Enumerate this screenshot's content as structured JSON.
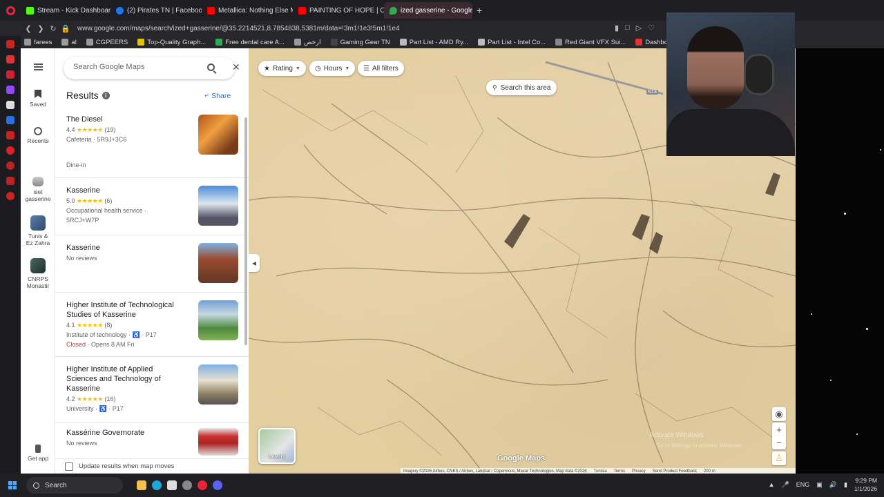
{
  "browser": {
    "tabs": [
      {
        "label": "Stream - Kick Dashboard",
        "color": "#53fc18",
        "active": false
      },
      {
        "label": "(2) Pirates TN | Facebook",
        "color": "#1877f2",
        "active": false
      },
      {
        "label": "Metallica: Nothing Else M",
        "color": "#ff0000",
        "active": false
      },
      {
        "label": "PAINTING OF HOPE | Offi",
        "color": "#ff0000",
        "active": false
      },
      {
        "label": "ized gasserine - Google M",
        "color": "#34a853",
        "active": true
      }
    ],
    "new_tab": "+",
    "url": "www.google.com/maps/search/ized+gasserine/@35.2214521,8.7854838,5381m/data=!3m1!1e3!5m1!1e4",
    "bookmarks": [
      {
        "label": "farees",
        "icon": "folder-icon",
        "color": "#9a9a9a"
      },
      {
        "label": "al",
        "icon": "folder-icon",
        "color": "#9a9a9a"
      },
      {
        "label": "CGPEERS",
        "icon": "folder-icon",
        "color": "#9a9a9a"
      },
      {
        "label": "Top-Quality Graph...",
        "icon": "graphics-icon",
        "color": "#e6c300"
      },
      {
        "label": "Free dental care A...",
        "icon": "dental-icon",
        "color": "#33aa55"
      },
      {
        "label": "ارخص",
        "icon": "folder-icon",
        "color": "#9a9a9a"
      },
      {
        "label": "Gaming Gear TN",
        "icon": "gear-site-icon",
        "color": "#444444"
      },
      {
        "label": "Part List - AMD Ry...",
        "icon": "partlist-icon",
        "color": "#bbbbbb"
      },
      {
        "label": "Part List - Intel Co...",
        "icon": "partlist-icon",
        "color": "#bbbbbb"
      },
      {
        "label": "Red Giant VFX Sui...",
        "icon": "redgiant-icon",
        "color": "#888888"
      },
      {
        "label": "Dashboard - BotG...",
        "icon": "dashboard-icon",
        "color": "#e33333"
      }
    ]
  },
  "rail": {
    "menu_icon": "menu-icon",
    "items": [
      {
        "label": "Saved",
        "icon": "bookmark-icon"
      },
      {
        "label": "Recents",
        "icon": "history-icon"
      },
      {
        "label": "iset gasserine",
        "icon": "place-thumbnail-icon"
      },
      {
        "label": "Tunis & Ez Zahra",
        "icon": "place-thumbnail-icon"
      },
      {
        "label": "CNRPS Monastir",
        "icon": "place-thumbnail-icon"
      },
      {
        "label": "Get app",
        "icon": "phone-icon"
      }
    ]
  },
  "search": {
    "placeholder": "Search Google Maps"
  },
  "results": {
    "title": "Results",
    "share_label": "Share",
    "items": [
      {
        "name": "The Diesel",
        "rating": "4.4",
        "stars": "★★★★★",
        "reviews": "(19)",
        "line2": "Cafeteria · 5R9J+3C6",
        "line3": "",
        "line4": "Dine-in"
      },
      {
        "name": "Kasserine",
        "rating": "5.0",
        "stars": "★★★★★",
        "reviews": "(6)",
        "line2": "Occupational health service ·",
        "line3": "5RCJ+W7P",
        "line4": ""
      },
      {
        "name": "Kasserine",
        "rating": "",
        "stars": "",
        "reviews": "",
        "line2": "No reviews",
        "line3": "",
        "line4": ""
      },
      {
        "name": "Higher Institute of Technological Studies of Kasserine",
        "rating": "4.1",
        "stars": "★★★★★",
        "reviews": "(8)",
        "line2": "Institute of technology · ♿ · P17",
        "line3_closed": "Closed",
        "line3": " · Opens 8 AM Fri",
        "line4": ""
      },
      {
        "name": "Higher Institute of Applied Sciences and Technology of Kasserine",
        "rating": "4.2",
        "stars": "★★★★★",
        "reviews": "(16)",
        "line2": "University · ♿ · P17",
        "line3": "",
        "line4": ""
      },
      {
        "name": "Kassérine Governorate",
        "rating": "",
        "stars": "",
        "reviews": "",
        "line2": "No reviews",
        "line3": "",
        "line4": ""
      }
    ],
    "update_label": "Update results when map moves"
  },
  "map": {
    "chips": [
      {
        "label": "Rating",
        "icon": "star-icon"
      },
      {
        "label": "Hours",
        "icon": "clock-icon"
      },
      {
        "label": "All filters",
        "icon": "filter-icon"
      }
    ],
    "search_area": "Search this area",
    "road_label": "N13",
    "layers_label": "Layers",
    "google_logo": "Google Maps",
    "attribution": [
      "Imagery ©2026 Airbus, CNES / Airbus, Landsat / Copernicus, Maxar Technologies, Map data ©2026",
      "Tunisia",
      "Terms",
      "Privacy",
      "Send Product Feedback",
      "200 m"
    ],
    "watermark_line1": "Activate Windows",
    "watermark_line2": "Go to Settings to activate Windows."
  },
  "taskbar": {
    "search_label": "Search",
    "lang": "ENG",
    "time": "9:29 PM",
    "date": "1/1/2026"
  }
}
